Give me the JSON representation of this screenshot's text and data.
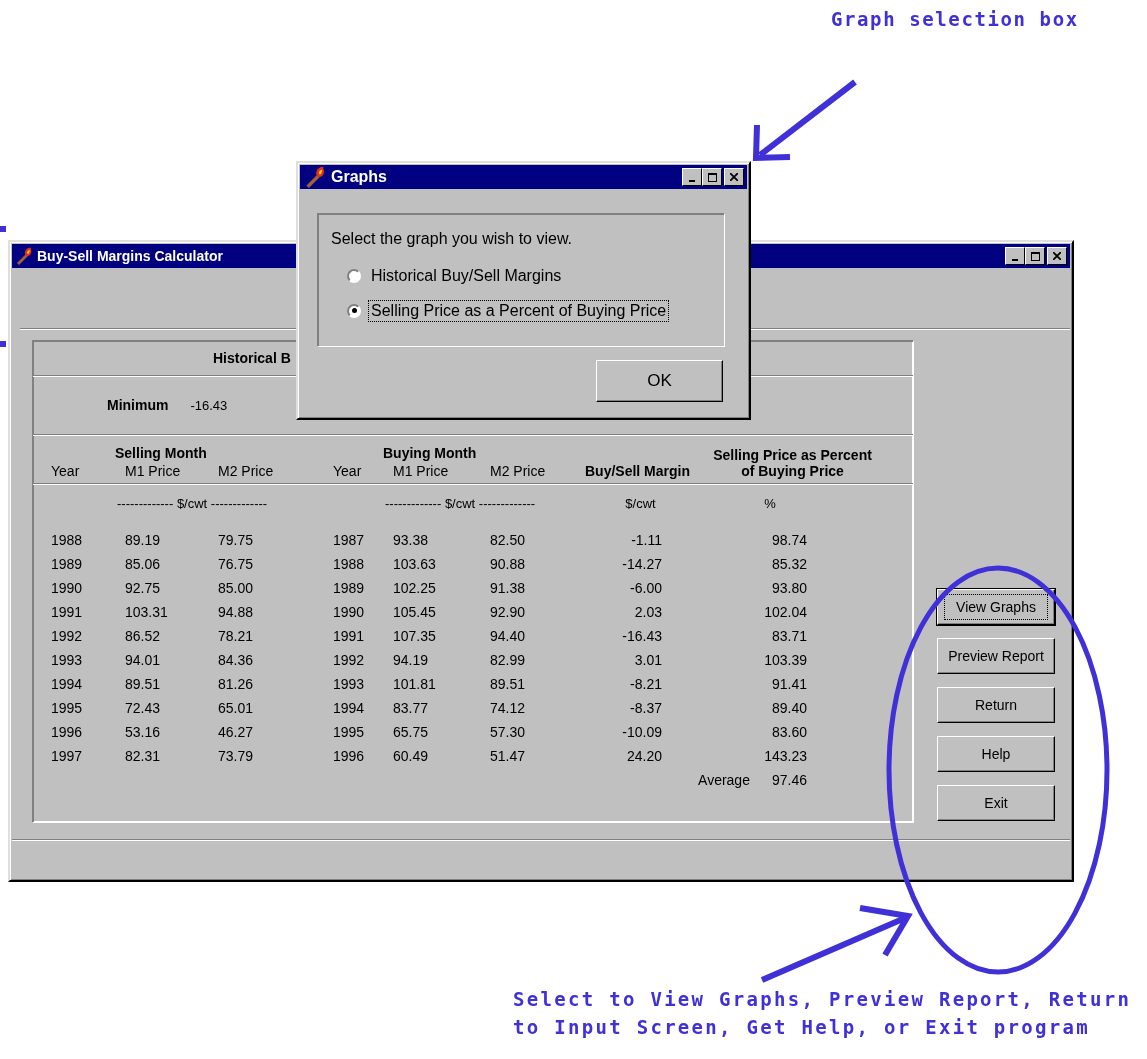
{
  "callouts": {
    "graph_box": "Graph selection box",
    "buttons": [
      "Select to View Graphs, Preview Report, Return",
      "to Input Screen, Get Help, or Exit program"
    ]
  },
  "main_window": {
    "title": "Buy-Sell Margins Calculator",
    "summary_title": "Historical B",
    "minimum_label": "Minimum",
    "minimum_value": "-16.43",
    "group_headers": [
      "Selling Month",
      "Buying Month"
    ],
    "columns": [
      "Year",
      "M1 Price",
      "M2 Price",
      "Year",
      "M1 Price",
      "M2 Price",
      "Buy/Sell Margin",
      "Selling Price as Percent of Buying Price"
    ],
    "units": [
      "------------- $/cwt -------------",
      "------------- $/cwt -------------",
      "$/cwt",
      "%"
    ],
    "rows": [
      [
        "1988",
        "89.19",
        "79.75",
        "1987",
        "93.38",
        "82.50",
        "-1.11",
        "98.74"
      ],
      [
        "1989",
        "85.06",
        "76.75",
        "1988",
        "103.63",
        "90.88",
        "-14.27",
        "85.32"
      ],
      [
        "1990",
        "92.75",
        "85.00",
        "1989",
        "102.25",
        "91.38",
        "-6.00",
        "93.80"
      ],
      [
        "1991",
        "103.31",
        "94.88",
        "1990",
        "105.45",
        "92.90",
        "2.03",
        "102.04"
      ],
      [
        "1992",
        "86.52",
        "78.21",
        "1991",
        "107.35",
        "94.40",
        "-16.43",
        "83.71"
      ],
      [
        "1993",
        "94.01",
        "84.36",
        "1992",
        "94.19",
        "82.99",
        "3.01",
        "103.39"
      ],
      [
        "1994",
        "89.51",
        "81.26",
        "1993",
        "101.81",
        "89.51",
        "-8.21",
        "91.41"
      ],
      [
        "1995",
        "72.43",
        "65.01",
        "1994",
        "83.77",
        "74.12",
        "-8.37",
        "89.40"
      ],
      [
        "1996",
        "53.16",
        "46.27",
        "1995",
        "65.75",
        "57.30",
        "-10.09",
        "83.60"
      ],
      [
        "1997",
        "82.31",
        "73.79",
        "1996",
        "60.49",
        "51.47",
        "24.20",
        "143.23"
      ]
    ],
    "average_label": "Average",
    "average_value": "97.46",
    "buttons": [
      {
        "label": "View Graphs",
        "focused": true
      },
      {
        "label": "Preview Report",
        "focused": false
      },
      {
        "label": "Return",
        "focused": false
      },
      {
        "label": "Help",
        "focused": false
      },
      {
        "label": "Exit",
        "focused": false
      }
    ]
  },
  "dialog": {
    "title": "Graphs",
    "prompt": "Select the graph you wish to view.",
    "options": [
      {
        "label": "Historical Buy/Sell Margins",
        "selected": false
      },
      {
        "label": "Selling Price as a Percent of Buying Price",
        "selected": true
      }
    ],
    "ok_button": "OK"
  }
}
